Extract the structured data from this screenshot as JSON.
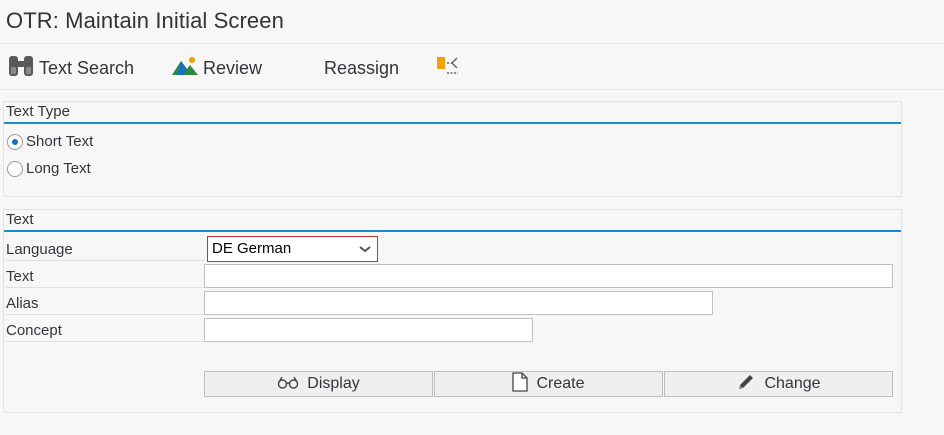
{
  "window": {
    "title": "OTR: Maintain Initial Screen"
  },
  "toolbar": {
    "text_search": "Text Search",
    "review": "Review",
    "reassign": "Reassign"
  },
  "text_type": {
    "title": "Text Type",
    "options": [
      {
        "label": "Short Text",
        "selected": true
      },
      {
        "label": "Long Text",
        "selected": false
      }
    ]
  },
  "text_group": {
    "title": "Text",
    "language": {
      "label": "Language",
      "value": "DE German"
    },
    "text": {
      "label": "Text",
      "value": ""
    },
    "alias": {
      "label": "Alias",
      "value": ""
    },
    "concept": {
      "label": "Concept",
      "value": ""
    }
  },
  "actions": {
    "display": "Display",
    "create": "Create",
    "change": "Change"
  },
  "colors": {
    "accent_line": "#1a8ccf",
    "focus_border": "#c83232",
    "icon_orange": "#f0a000",
    "icon_green": "#2e8b3d",
    "icon_blue": "#1a6fb8"
  }
}
